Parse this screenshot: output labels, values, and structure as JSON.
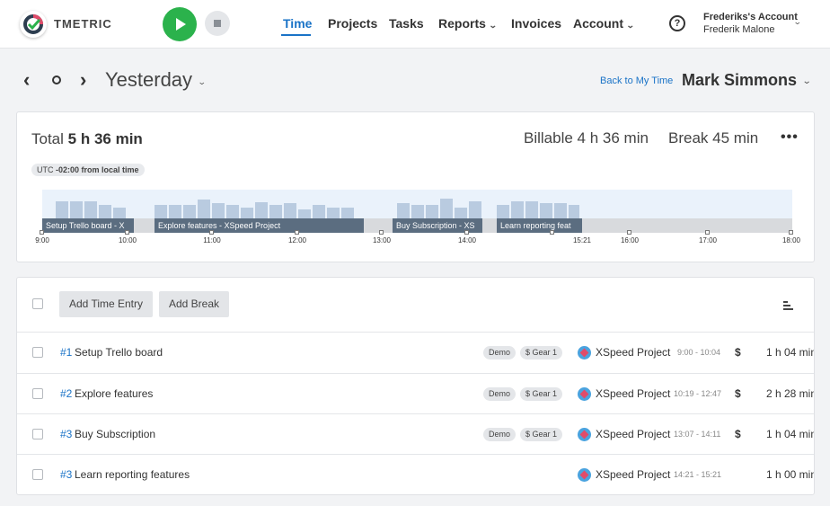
{
  "app": {
    "name": "TMETRIC"
  },
  "nav": {
    "time": "Time",
    "projects": "Projects",
    "tasks": "Tasks",
    "reports": "Reports",
    "invoices": "Invoices",
    "account": "Account"
  },
  "account": {
    "workspace": "Frederiks's Account",
    "user": "Frederik Malone"
  },
  "header": {
    "date_label": "Yesterday",
    "back_link": "Back to My Time",
    "viewed_user": "Mark Simmons"
  },
  "summary": {
    "total_label": "Total",
    "total_value": "5 h 36 min",
    "billable_label": "Billable",
    "billable_value": "4 h 36 min",
    "break_label": "Break",
    "break_value": "45 min",
    "more": "•••",
    "utc_prefix": "UTC",
    "utc_offset": "-02:00 from local time"
  },
  "timeline": {
    "segments": [
      "Setup Trello board - X",
      "Explore features - XSpeed Project",
      "Buy Subscription - XS",
      "Learn reporting feat"
    ],
    "tick_labels": [
      "9:00",
      "10:00",
      "11:00",
      "12:00",
      "13:00",
      "14:00",
      "15:21",
      "16:00",
      "17:00",
      "18:00"
    ]
  },
  "toolbar": {
    "add_entry": "Add Time Entry",
    "add_break": "Add Break"
  },
  "entries": [
    {
      "num": "#1",
      "desc": "Setup Trello board",
      "tags": [
        "Demo",
        "$ Gear 1"
      ],
      "project": "XSpeed Project",
      "time": "9:00 - 10:04",
      "billable": "$",
      "duration": "1 h 04 min"
    },
    {
      "num": "#2",
      "desc": "Explore features",
      "tags": [
        "Demo",
        "$ Gear 1"
      ],
      "project": "XSpeed Project",
      "time": "10:19 - 12:47",
      "billable": "$",
      "duration": "2 h 28 min"
    },
    {
      "num": "#3",
      "desc": "Buy Subscription",
      "tags": [
        "Demo",
        "$ Gear 1"
      ],
      "project": "XSpeed Project",
      "time": "13:07 - 14:11",
      "billable": "$",
      "duration": "1 h 04 min"
    },
    {
      "num": "#3",
      "desc": "Learn reporting features",
      "tags": [],
      "project": "XSpeed Project",
      "time": "14:21 - 15:21",
      "billable": "",
      "duration": "1 h 00 min"
    }
  ],
  "colors": {
    "accent": "#1a73c7",
    "play": "#2bb24c",
    "segment": "#5b6d80"
  },
  "icons": [
    "logo-icon",
    "play-icon",
    "stop-icon",
    "help-icon",
    "chevron-left-icon",
    "today-icon",
    "chevron-right-icon",
    "more-icon",
    "sort-icon",
    "project-icon"
  ]
}
